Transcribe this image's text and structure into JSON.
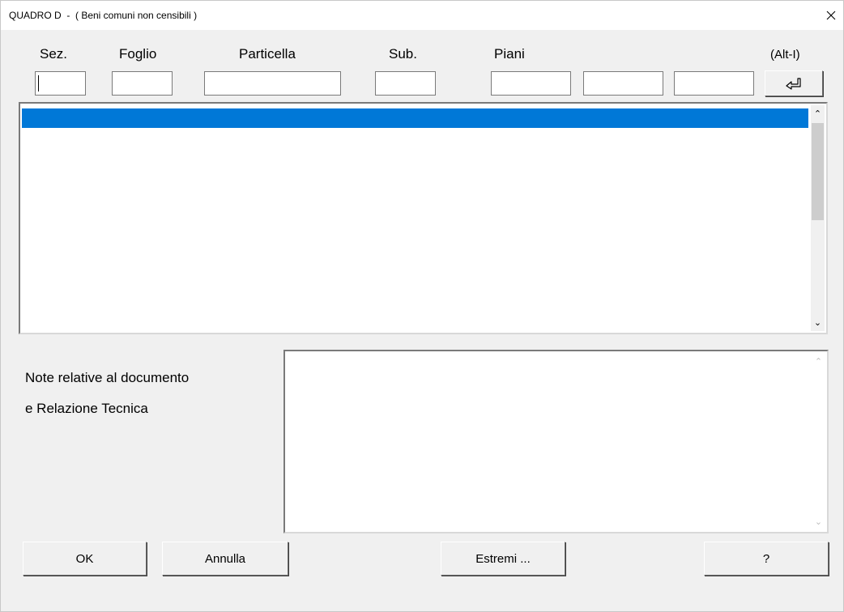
{
  "window": {
    "title": "QUADRO D  -  ( Beni comuni non censibili )"
  },
  "icons": {
    "close": "close-icon",
    "insert": "enter-arrow-icon"
  },
  "headers": {
    "sez": "Sez.",
    "foglio": "Foglio",
    "particella": "Particella",
    "sub": "Sub.",
    "piani": "Piani",
    "shortcut": "(Alt-I)"
  },
  "fields": {
    "sez": "",
    "foglio": "",
    "particella": "",
    "sub": "",
    "piani1": "",
    "piani2": "",
    "piani3": ""
  },
  "list": {
    "items": [
      ""
    ]
  },
  "notes": {
    "label_line1": "Note relative al documento",
    "label_line2": "e Relazione Tecnica",
    "value": ""
  },
  "buttons": {
    "ok": "OK",
    "annulla": "Annulla",
    "estremi": "Estremi ...",
    "help": "?"
  },
  "colors": {
    "selection": "#0078d7",
    "background": "#f0f0f0"
  }
}
